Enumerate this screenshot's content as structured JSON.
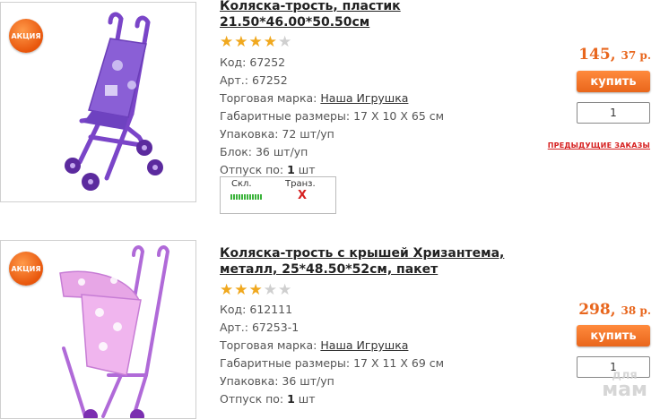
{
  "badge_label": "АКЦИЯ",
  "buy_label": "купить",
  "prev_orders_label": "ПРЕДЫДУЩИЕ ЗАКАЗЫ",
  "watermark": {
    "line1": "для",
    "line2": "мам"
  },
  "products": [
    {
      "title": "Коляска-трость, пластик 21.50*46.00*50.50см",
      "rating": 4,
      "code_label": "Код:",
      "code": "67252",
      "art_label": "Арт.:",
      "art": "67252",
      "brand_label": "Торговая марка:",
      "brand": "Наша Игрушка",
      "size_label": "Габаритные размеры:",
      "size": "17 X 10 X 65 см",
      "pack_label": "Упаковка:",
      "pack": "72 шт/уп",
      "block_label": "Блок:",
      "block": "36 шт/уп",
      "release_label": "Отпуск по:",
      "release": "1",
      "release_unit": "шт",
      "stock_warehouse_label": "Скл.",
      "stock_transit_label": "Транз.",
      "stock_transit_value": "X",
      "price_rub": "145,",
      "price_kop": "37 р.",
      "qty": "1",
      "colors": {
        "frame": "#7a45c8",
        "fabric": "#8a5fd6",
        "wheel": "#5b2a9e"
      }
    },
    {
      "title": "Коляска-трость с крышей Хризантема, металл, 25*48.50*52см, пакет",
      "rating": 3,
      "code_label": "Код:",
      "code": "612111",
      "art_label": "Арт.:",
      "art": "67253-1",
      "brand_label": "Торговая марка:",
      "brand": "Наша Игрушка",
      "size_label": "Габаритные размеры:",
      "size": "17 X 11 X 69 см",
      "pack_label": "Упаковка:",
      "pack": "36 шт/уп",
      "release_label": "Отпуск по:",
      "release": "1",
      "release_unit": "шт",
      "price_rub": "298,",
      "price_kop": "38 р.",
      "qty": "1",
      "colors": {
        "frame": "#b06ad8",
        "fabric": "#e7a6e6",
        "wheel": "#7b2fb0"
      }
    }
  ]
}
